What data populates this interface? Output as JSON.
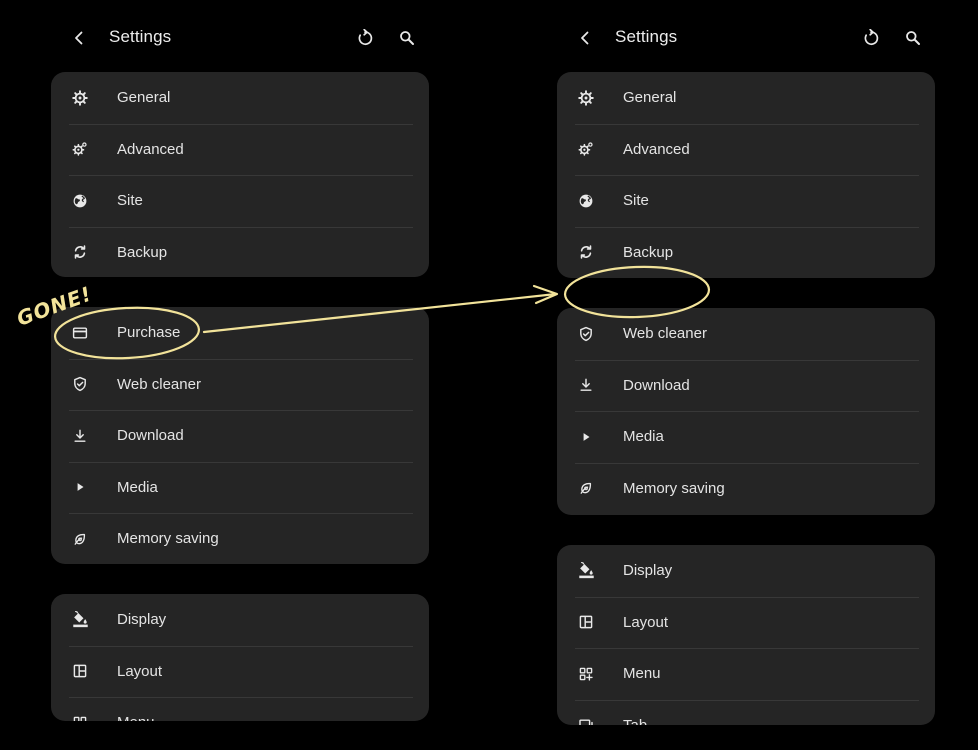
{
  "left": {
    "title": "Settings",
    "groups": [
      [
        "General",
        "Advanced",
        "Site",
        "Backup"
      ],
      [
        "Purchase",
        "Web cleaner",
        "Download",
        "Media",
        "Memory saving"
      ],
      [
        "Display",
        "Layout",
        "Menu"
      ]
    ]
  },
  "right": {
    "title": "Settings",
    "groups": [
      [
        "General",
        "Advanced",
        "Site",
        "Backup"
      ],
      [
        "Web cleaner",
        "Download",
        "Media",
        "Memory saving"
      ],
      [
        "Display",
        "Layout",
        "Menu",
        "Tab"
      ]
    ]
  },
  "annotation": {
    "text": "GONE!",
    "color": "#f2e39a"
  },
  "icons": {
    "General": "gear-icon",
    "Advanced": "gears-icon",
    "Site": "globe-icon",
    "Backup": "sync-icon",
    "Purchase": "credit-card-icon",
    "Web cleaner": "shield-check-icon",
    "Download": "download-icon",
    "Media": "play-icon",
    "Memory saving": "leaf-icon",
    "Display": "paint-bucket-icon",
    "Layout": "layout-icon",
    "Menu": "grid-plus-icon",
    "Tab": "tab-icon"
  }
}
